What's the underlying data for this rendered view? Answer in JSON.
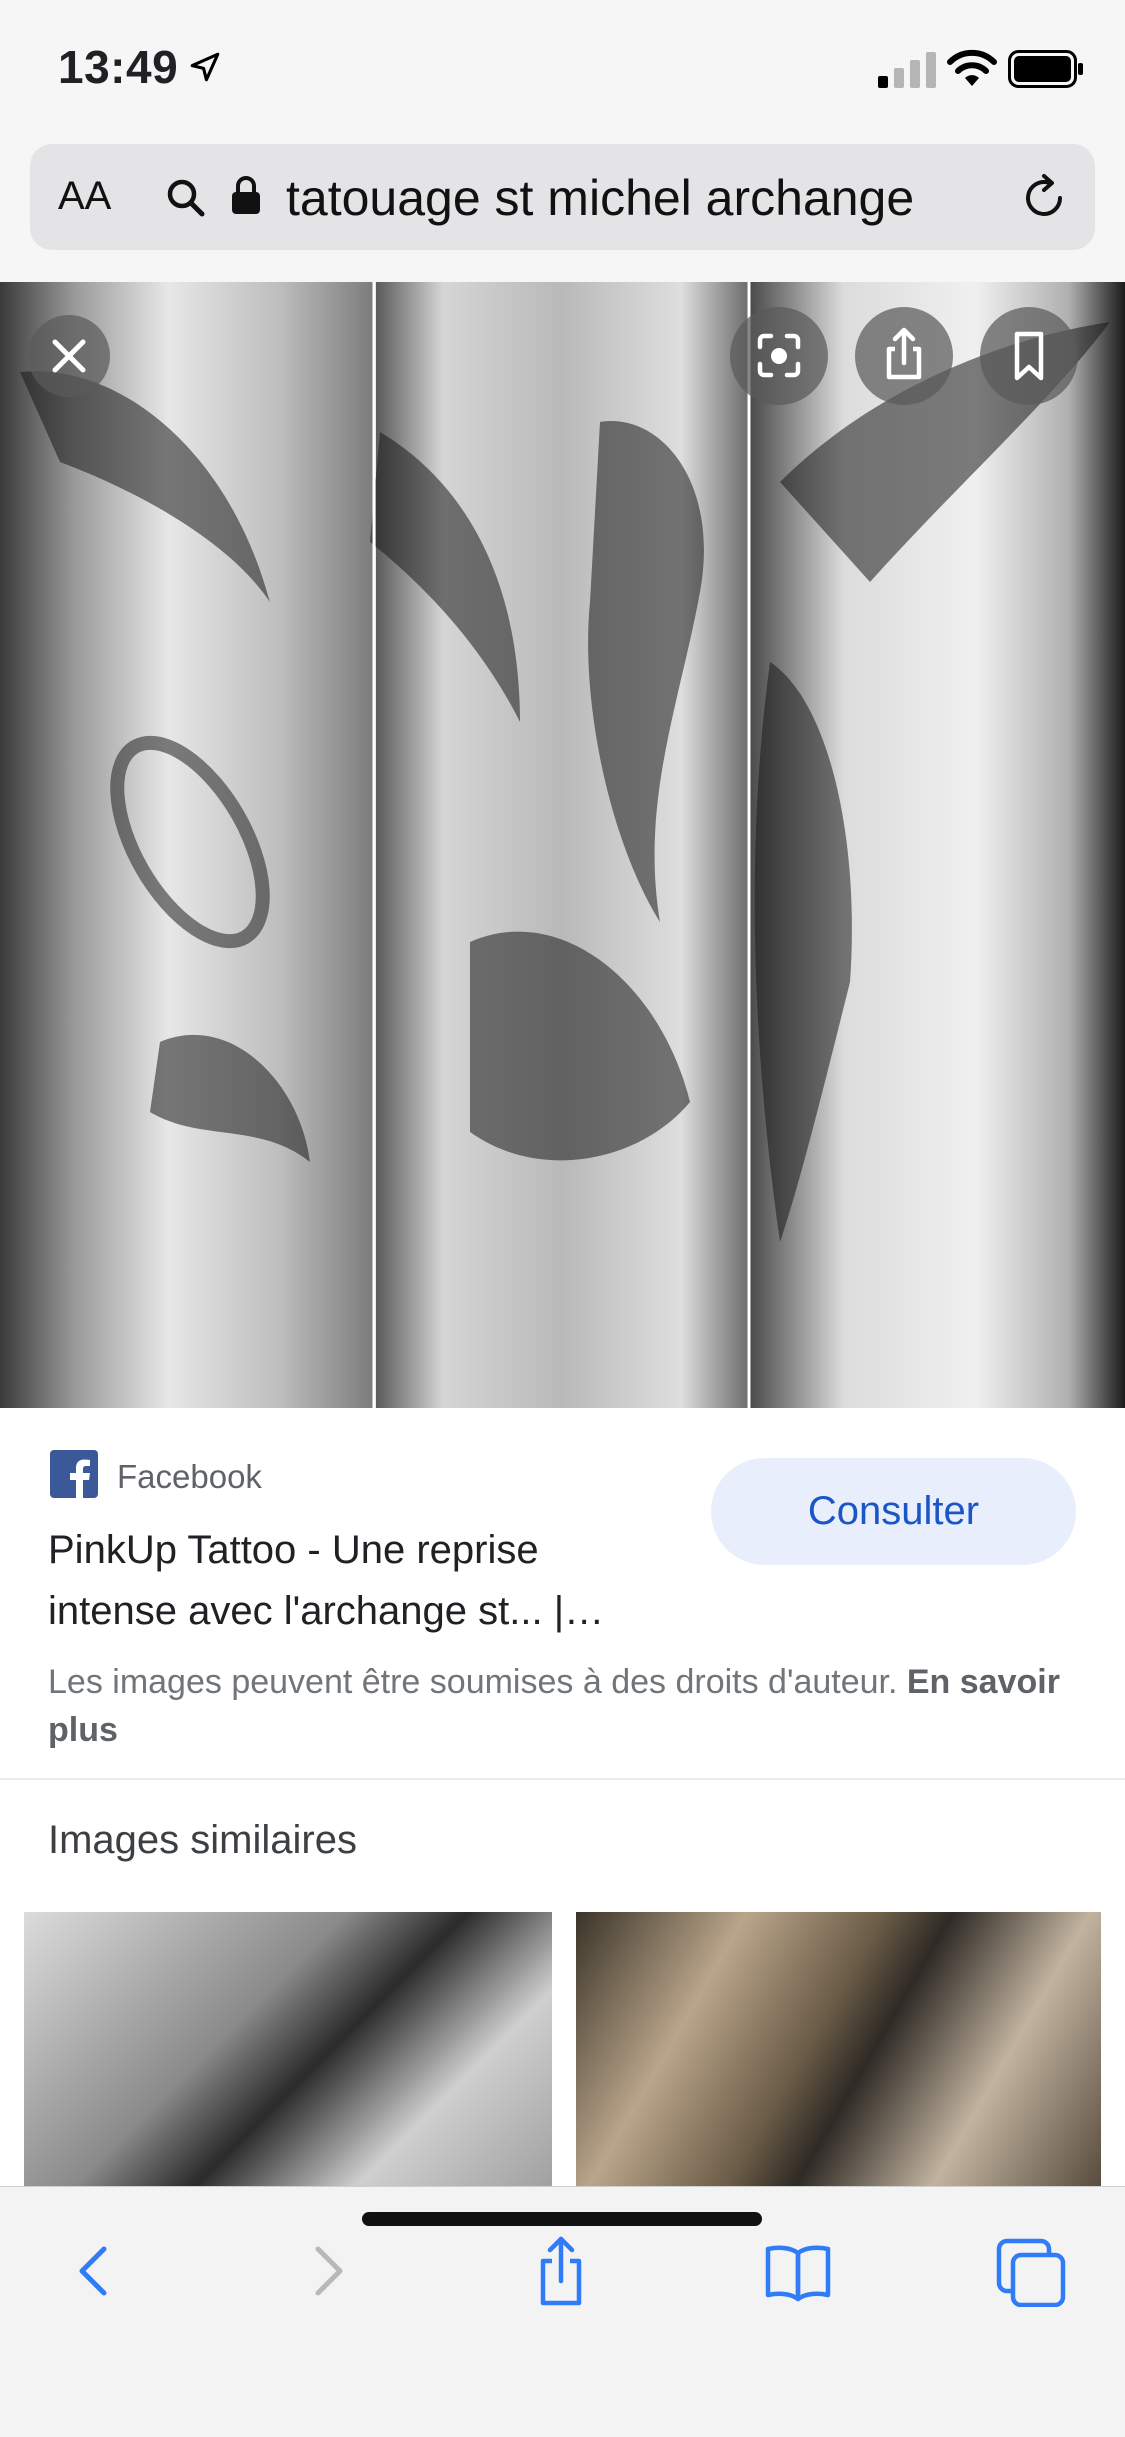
{
  "status_bar": {
    "time": "13:49",
    "icons": [
      "location-arrow-icon",
      "cellular-signal-icon",
      "wifi-icon",
      "battery-icon"
    ]
  },
  "address_bar": {
    "text_size_button": "AA",
    "url": "tatouage st michel archange",
    "icons": [
      "search-icon",
      "lock-icon",
      "reload-icon"
    ]
  },
  "image_viewer": {
    "buttons": [
      "close-icon",
      "lens-search-icon",
      "share-icon",
      "bookmark-icon"
    ]
  },
  "result": {
    "source": "Facebook",
    "title": "PinkUp Tattoo - Une reprise intense avec l'archange st... |…",
    "action_label": "Consulter",
    "copyright_text": "Les images peuvent être soumises à des droits d'auteur.",
    "learn_more": "En savoir plus"
  },
  "similar": {
    "heading": "Images similaires"
  },
  "toolbar": {
    "icons": [
      "back-icon",
      "forward-icon",
      "share-icon",
      "bookmarks-icon",
      "tabs-icon"
    ]
  },
  "colors": {
    "accent_blue": "#1a56c4",
    "button_bg": "#e8eefc",
    "toolbar_icon": "#2f7cf6",
    "facebook_blue": "#3b5998"
  }
}
